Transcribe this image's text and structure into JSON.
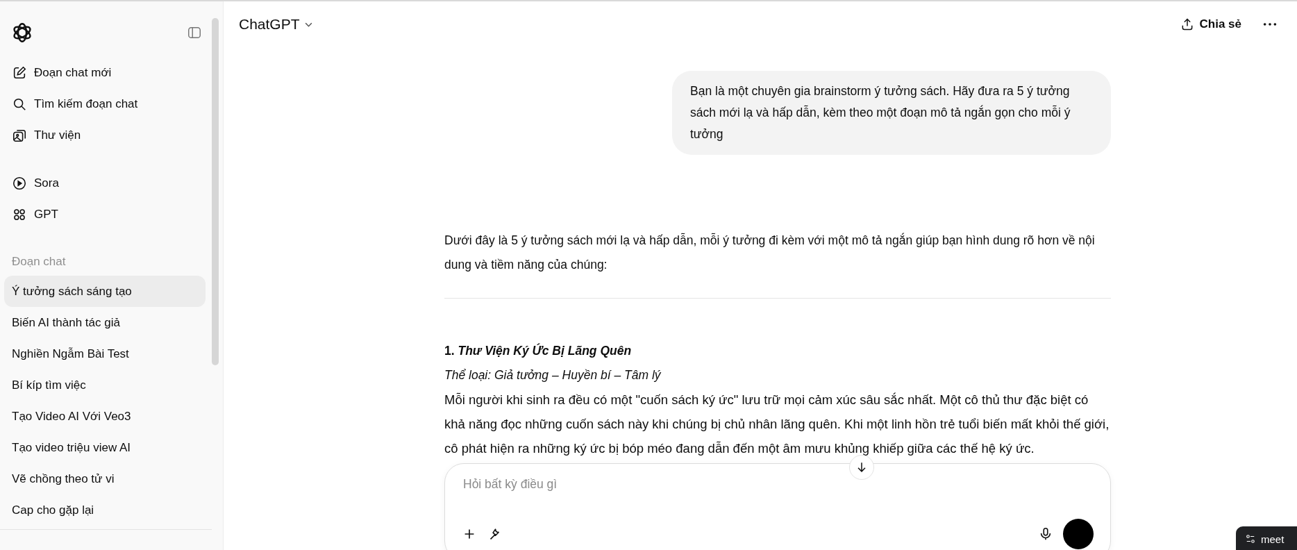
{
  "sidebar": {
    "nav": [
      {
        "label": "Đoạn chat mới",
        "kind": "edit"
      },
      {
        "label": "Tìm kiếm đoạn chat",
        "kind": "search"
      },
      {
        "label": "Thư viện",
        "kind": "library"
      }
    ],
    "explore": [
      {
        "label": "Sora",
        "kind": "play"
      },
      {
        "label": "GPT",
        "kind": "grid"
      }
    ],
    "section_label": "Đoạn chat",
    "chats": [
      {
        "title": "Ý tưởng sách sáng tạo",
        "selected": true
      },
      {
        "title": "Biến AI thành tác giả",
        "selected": false
      },
      {
        "title": "Nghiền Ngẫm Bài Test",
        "selected": false
      },
      {
        "title": "Bí kíp tìm việc",
        "selected": false
      },
      {
        "title": "Tạo Video AI Với Veo3",
        "selected": false
      },
      {
        "title": "Tạo video triệu view AI",
        "selected": false
      },
      {
        "title": "Vẽ chồng theo tử vi",
        "selected": false
      },
      {
        "title": "Cap cho gặp lại",
        "selected": false
      }
    ]
  },
  "header": {
    "title": "ChatGPT",
    "share": "Chia sẻ"
  },
  "conversation": {
    "user_message": "Bạn là một chuyên gia brainstorm ý tưởng sách. Hãy đưa ra 5 ý tưởng sách mới lạ và hấp dẫn, kèm theo một đoạn mô tả ngắn gọn cho mỗi ý tưởng",
    "intro": "Dưới đây là 5 ý tưởng sách mới lạ và hấp dẫn, mỗi ý tưởng đi kèm với một mô tả ngắn giúp bạn hình dung rõ hơn về nội dung và tiềm năng của chúng:",
    "ideas": [
      {
        "heading": "1. *Thư Viện Ký Ức Bị Lãng Quên*",
        "genre": "Thể loại: Giả tưởng – Huyền bí – Tâm lý",
        "description": "Mỗi người khi sinh ra đều có một \"cuốn sách ký ức\" lưu trữ mọi cảm xúc sâu sắc nhất. Một cô thủ thư đặc biệt có khả năng đọc những cuốn sách này khi chúng bị chủ nhân lãng quên. Khi một linh hồn trẻ tuổi biến mất khỏi thế giới, cô phát hiện ra những ký ức bị bóp méo đang dẫn đến một âm mưu khủng khiếp giữa các thế hệ ký ức."
      }
    ]
  },
  "composer": {
    "placeholder": "Hỏi bất kỳ điều gì"
  },
  "toast": {
    "text": "meet"
  }
}
